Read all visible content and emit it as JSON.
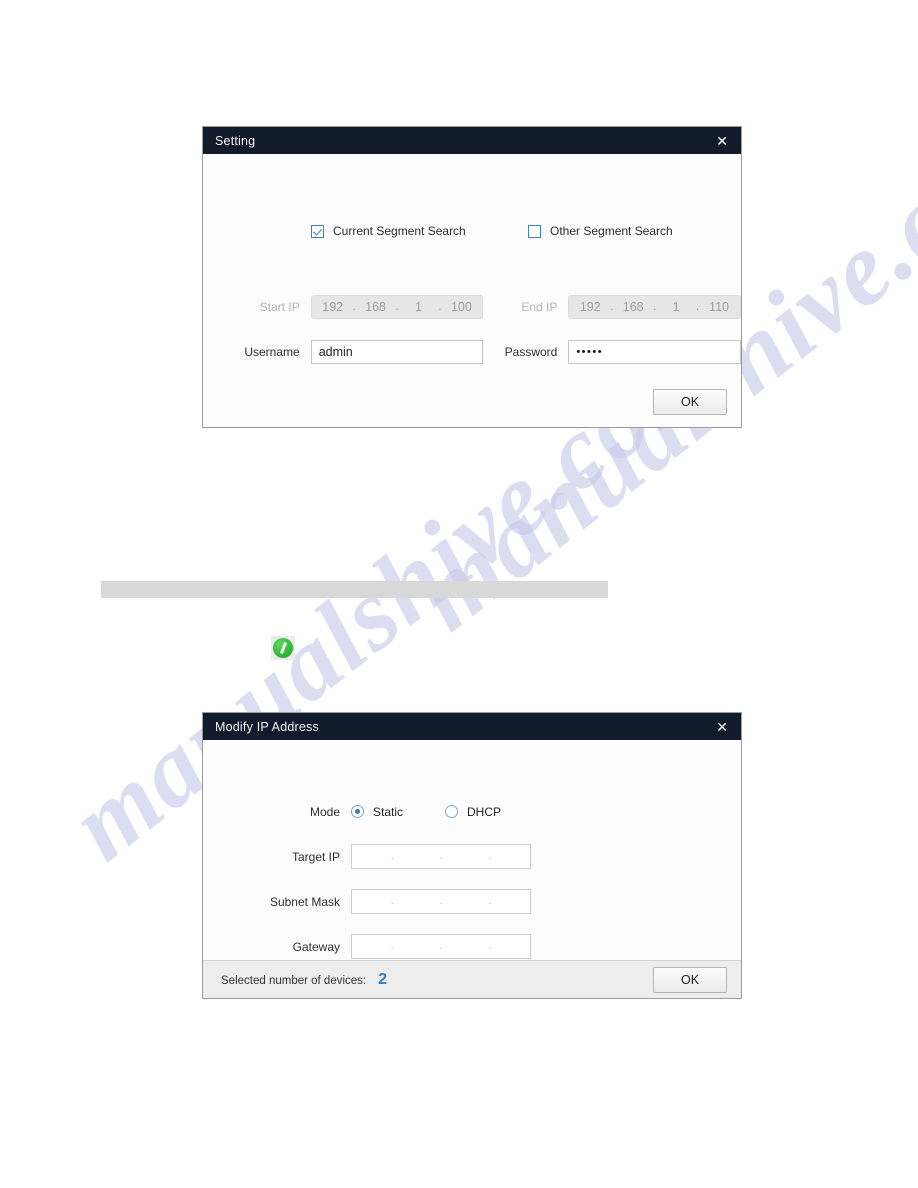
{
  "page": {
    "watermark_text": "manualshive.com"
  },
  "setting_dialog": {
    "title": "Setting",
    "close_icon": "close-icon",
    "checkboxes": [
      {
        "label": "Current Segment Search",
        "checked": true
      },
      {
        "label": "Other Segment Search",
        "checked": false
      }
    ],
    "start_ip": {
      "label": "Start IP",
      "disabled": true,
      "octets": [
        "192",
        "168",
        "1",
        "100"
      ],
      "separator": "."
    },
    "end_ip": {
      "label": "End IP",
      "disabled": true,
      "octets": [
        "192",
        "168",
        "1",
        "110"
      ],
      "separator": "."
    },
    "username": {
      "label": "Username",
      "value": "admin",
      "placeholder": ""
    },
    "password": {
      "label": "Password",
      "value": "•••••",
      "placeholder": ""
    },
    "ok_label": "OK"
  },
  "redacted_bar": {
    "text": ""
  },
  "edit_icon": {
    "name": "edit-pencil-icon",
    "color": "#2fb936"
  },
  "modify_dialog": {
    "title": "Modify IP Address",
    "close_icon": "close-icon",
    "mode": {
      "label": "Mode",
      "options": [
        {
          "label": "Static",
          "selected": true
        },
        {
          "label": "DHCP",
          "selected": false
        }
      ]
    },
    "target_ip": {
      "label": "Target IP",
      "value": "",
      "separator": "."
    },
    "subnet_mask": {
      "label": "Subnet Mask",
      "value": "",
      "separator": "."
    },
    "gateway": {
      "label": "Gateway",
      "value": "",
      "separator": "."
    },
    "footer": {
      "text": "Selected number of devices:",
      "count": "2"
    },
    "ok_label": "OK"
  }
}
